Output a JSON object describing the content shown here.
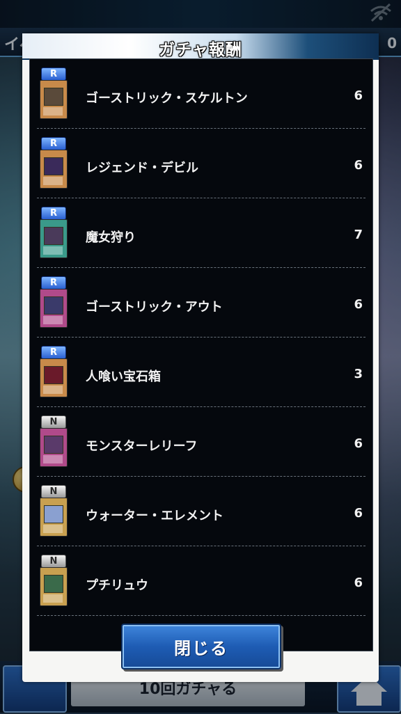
{
  "background": {
    "tab_text": "イベ",
    "right_value": "0",
    "bottom_button_label": "10回ガチャる"
  },
  "modal": {
    "title": "ガチャ報酬",
    "close_label": "閉じる",
    "items": [
      {
        "rarity": "R",
        "name": "ゴーストリック・スケルトン",
        "qty": "6",
        "card_color": "#c88a4a",
        "art_color": "#5a4a3a"
      },
      {
        "rarity": "R",
        "name": "レジェンド・デビル",
        "qty": "6",
        "card_color": "#c88a4a",
        "art_color": "#3a2a5a"
      },
      {
        "rarity": "R",
        "name": "魔女狩り",
        "qty": "7",
        "card_color": "#3a9a8a",
        "art_color": "#4a3a5a"
      },
      {
        "rarity": "R",
        "name": "ゴーストリック・アウト",
        "qty": "6",
        "card_color": "#b04a8a",
        "art_color": "#3a3a6a"
      },
      {
        "rarity": "R",
        "name": "人喰い宝石箱",
        "qty": "3",
        "card_color": "#c88a4a",
        "art_color": "#6a1a2a"
      },
      {
        "rarity": "N",
        "name": "モンスターレリーフ",
        "qty": "6",
        "card_color": "#b04a8a",
        "art_color": "#5a3a6a"
      },
      {
        "rarity": "N",
        "name": "ウォーター・エレメント",
        "qty": "6",
        "card_color": "#c8a050",
        "art_color": "#8aa0d0"
      },
      {
        "rarity": "N",
        "name": "プチリュウ",
        "qty": "6",
        "card_color": "#c8a050",
        "art_color": "#3a6a4a"
      }
    ]
  }
}
